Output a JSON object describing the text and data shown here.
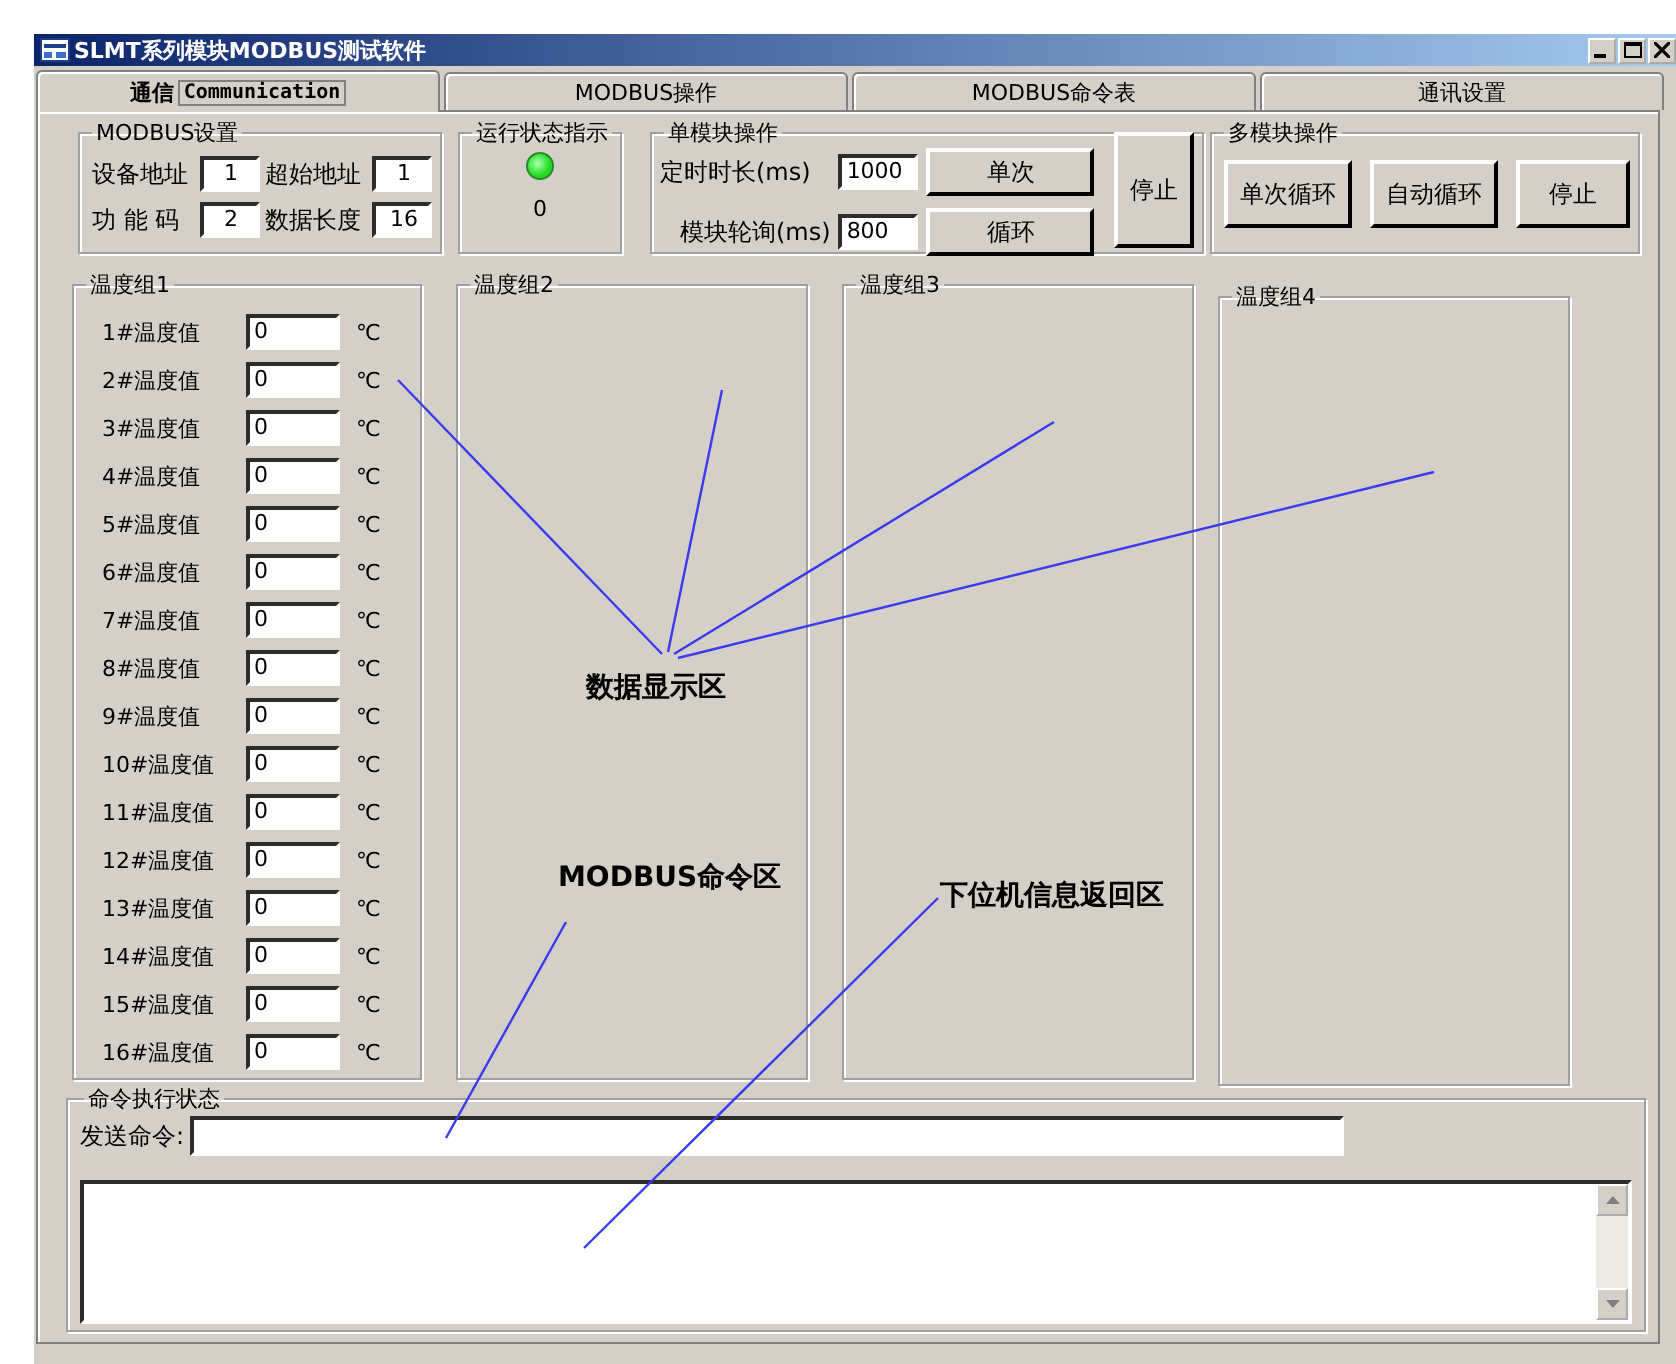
{
  "window": {
    "title": "SLMT系列模块MODBUS测试软件"
  },
  "tabs": [
    {
      "label": "通信",
      "sublabel": "Communication",
      "selected": true
    },
    {
      "label": "MODBUS操作",
      "selected": false
    },
    {
      "label": "MODBUS命令表",
      "selected": false
    },
    {
      "label": "通讯设置",
      "selected": false
    }
  ],
  "modbus_settings": {
    "title": "MODBUS设置",
    "fields": [
      {
        "label": "设备地址",
        "value": "1"
      },
      {
        "label": "超始地址",
        "value": "1"
      },
      {
        "label": "功 能 码",
        "value": "2"
      },
      {
        "label": "数据长度",
        "value": "16"
      }
    ]
  },
  "run_status": {
    "title": "运行状态指示",
    "on": true,
    "count": "0"
  },
  "single_module": {
    "title": "单模块操作",
    "fields": [
      {
        "label": "定时时长(ms)",
        "value": "1000"
      },
      {
        "label": "模块轮询(ms)",
        "value": "800"
      }
    ],
    "buttons": [
      "单次",
      "循环"
    ],
    "stop_button": "停止"
  },
  "multi_module": {
    "title": "多模块操作",
    "buttons": [
      "单次循环",
      "自动循环",
      "停止"
    ]
  },
  "temperature_groups": [
    {
      "title": "温度组1",
      "rows": [
        {
          "label": "1#温度值",
          "value": "0",
          "unit": "℃"
        },
        {
          "label": "2#温度值",
          "value": "0",
          "unit": "℃"
        },
        {
          "label": "3#温度值",
          "value": "0",
          "unit": "℃"
        },
        {
          "label": "4#温度值",
          "value": "0",
          "unit": "℃"
        },
        {
          "label": "5#温度值",
          "value": "0",
          "unit": "℃"
        },
        {
          "label": "6#温度值",
          "value": "0",
          "unit": "℃"
        },
        {
          "label": "7#温度值",
          "value": "0",
          "unit": "℃"
        },
        {
          "label": "8#温度值",
          "value": "0",
          "unit": "℃"
        },
        {
          "label": "9#温度值",
          "value": "0",
          "unit": "℃"
        },
        {
          "label": "10#温度值",
          "value": "0",
          "unit": "℃"
        },
        {
          "label": "11#温度值",
          "value": "0",
          "unit": "℃"
        },
        {
          "label": "12#温度值",
          "value": "0",
          "unit": "℃"
        },
        {
          "label": "13#温度值",
          "value": "0",
          "unit": "℃"
        },
        {
          "label": "14#温度值",
          "value": "0",
          "unit": "℃"
        },
        {
          "label": "15#温度值",
          "value": "0",
          "unit": "℃"
        },
        {
          "label": "16#温度值",
          "value": "0",
          "unit": "℃"
        }
      ]
    },
    {
      "title": "温度组2"
    },
    {
      "title": "温度组3"
    },
    {
      "title": "温度组4"
    }
  ],
  "command_status": {
    "title": "命令执行状态",
    "send_label": "发送命令:"
  },
  "annotations": [
    {
      "text": "数据显示区"
    },
    {
      "text": "MODBUS命令区"
    },
    {
      "text": "下位机信息返回区"
    }
  ]
}
